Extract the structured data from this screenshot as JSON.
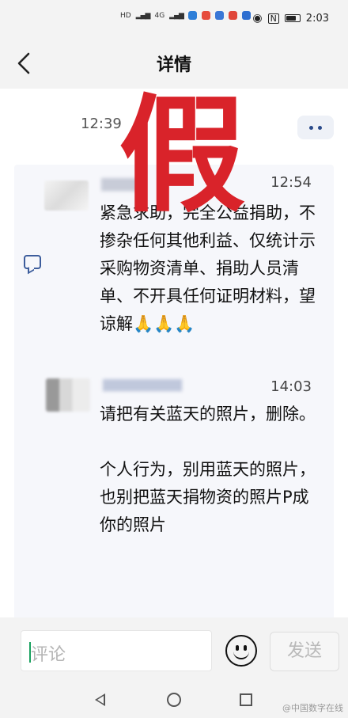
{
  "status_bar": {
    "time": "2:03",
    "sim1_label": "HD",
    "sim2_label": "HD",
    "signal1": "4G",
    "signal2": "4G",
    "battery_level": 0.8
  },
  "header": {
    "title": "详情"
  },
  "overlay": {
    "fake_stamp": "假"
  },
  "thread": {
    "top_time": "12:39",
    "messages": [
      {
        "time": "12:54",
        "text": "紧急求助，完全公益捐助，不掺杂任何其他利益、仅统计示采购物资清单、捐助人员清单、不开具任何证明材料，望谅解🙏🙏🙏"
      },
      {
        "time": "14:03",
        "text": "请把有关蓝天的照片，删除。\n\n个人行为，别用蓝天的照片，也别把蓝天捐物资的照片P成你的照片"
      }
    ]
  },
  "comment_bar": {
    "placeholder": "评论",
    "send_label": "发送"
  },
  "watermark": {
    "text": "@中国数字在线"
  },
  "colors": {
    "accent_blue": "#2a4a8a",
    "stamp_red": "#d9232a",
    "caret_green": "#19a15f"
  }
}
